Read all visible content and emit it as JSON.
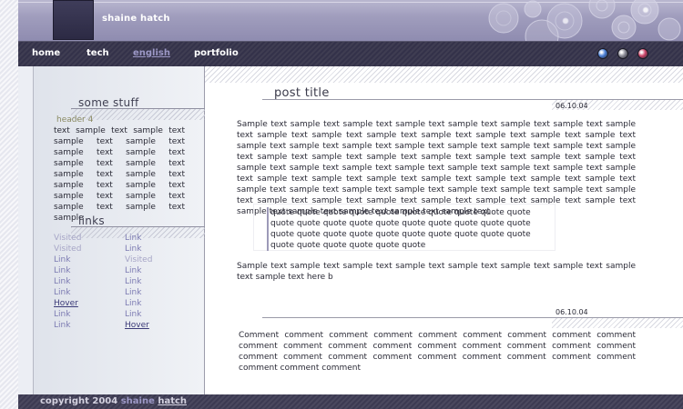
{
  "site": {
    "title": "shaine hatch"
  },
  "nav": {
    "items": [
      {
        "label": "home"
      },
      {
        "label": "tech"
      },
      {
        "label": "english"
      },
      {
        "label": "portfolio"
      }
    ]
  },
  "window_buttons": {
    "colors": [
      "#4a7fd6",
      "#8c8c96",
      "#cc4468"
    ]
  },
  "sidebar": {
    "stuff": {
      "heading": "some stuff",
      "subheading": "header 4",
      "text": "text sample text sample text sample text sample text sample text sample text sample text sample text sample text sample text sample text sample text sample text sample text sample text sample text sample"
    },
    "links": {
      "heading": "links",
      "col1": [
        "Visited",
        "Visited",
        "Link",
        "Link",
        "Link",
        "Link",
        "Hover",
        "Link",
        "Link"
      ],
      "col2": [
        "Link",
        "Link",
        "Visited",
        "Link",
        "Link",
        "Link",
        "Link",
        "Link",
        "Hover"
      ]
    }
  },
  "post": {
    "title": "post title",
    "date": "06.10.04",
    "body": "Sample text sample text sample text sample text sample text sample text sample text sample text sample text sample text sample text sample text sample text sample text sample text sample text sample text sample text sample text sample text sample text sample text sample text sample text sample text sample text sample text sample text sample text sample text sample text sample text sample text sample text sample text sample text sample text sample text sample text sample text sample text sample text sample text sample text sample text sample text sample text sample text sample text sample text sample text sample text sample text sample text sample text sample text sample text sample text sample text sample text sample text sample text sample text sample text sample text",
    "quote": "quote quote quote quote quote quote quote quote quote quote quote quote quote quote quote quote quote quote quote quote quote quote quote quote quote quote quote quote quote quote quote quote quote quote quote quote",
    "body2": "Sample text sample text sample text sample text sample text sample text sample text sample text sample text here b"
  },
  "comment": {
    "date": "06.10.04",
    "text": "Comment comment comment comment comment comment comment comment comment comment comment comment comment comment comment comment comment comment comment comment comment comment comment comment comment comment comment comment comment comment"
  },
  "footer": {
    "prefix": "copyright 2004",
    "name": "shaine",
    "link": "hatch"
  }
}
